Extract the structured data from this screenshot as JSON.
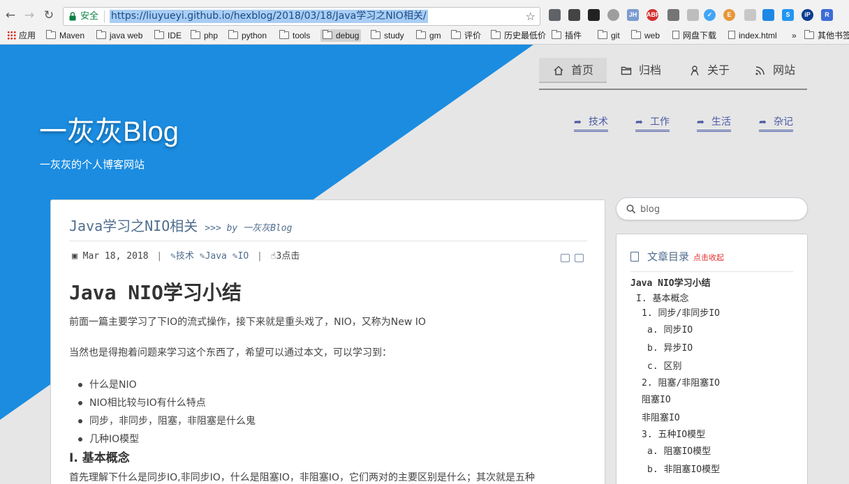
{
  "browser": {
    "back": "←",
    "forward": "→",
    "reload": "↻",
    "secure_label": "安全",
    "url": "https://liuyueyi.github.io/hexblog/2018/03/18/Java学习之NIO相关/",
    "star": "☆",
    "extensions": [
      {
        "icon": "extension-puzzle-icon",
        "text": "",
        "color": "#5f6368"
      },
      {
        "icon": "qr-code-icon",
        "text": "",
        "color": "#444444"
      },
      {
        "icon": "qr-grid-icon",
        "text": "",
        "color": "#222222"
      },
      {
        "icon": "globe-icon",
        "text": "",
        "color": "#9e9e9e"
      },
      {
        "icon": "jh-icon",
        "text": "JH",
        "color": "#7b9bd1"
      },
      {
        "icon": "adblock-icon",
        "text": "ABP",
        "color": "#d32f2f"
      },
      {
        "icon": "gear-icon",
        "text": "",
        "color": "#757575"
      },
      {
        "icon": "tree-icon",
        "text": "",
        "color": "#bdbdbd"
      },
      {
        "icon": "check-icon",
        "text": "✓",
        "color": "#42a5f5"
      },
      {
        "icon": "e-icon",
        "text": "E",
        "color": "#e6963a"
      },
      {
        "icon": "gray-box-icon",
        "text": "",
        "color": "#c7c7c7"
      },
      {
        "icon": "pocket-icon",
        "text": "",
        "color": "#1e88e5"
      },
      {
        "icon": "s-icon",
        "text": "S",
        "color": "#2196f3"
      },
      {
        "icon": "ip-icon",
        "text": "iP",
        "color": "#0b3d91"
      },
      {
        "icon": "r-icon",
        "text": "R",
        "color": "#3d6bd8"
      }
    ],
    "bookmarks": [
      {
        "label": "应用",
        "kind": "apps"
      },
      {
        "label": "Maven",
        "kind": "folder"
      },
      {
        "label": "java web",
        "kind": "folder"
      },
      {
        "label": "IDE",
        "kind": "folder"
      },
      {
        "label": "php",
        "kind": "folder"
      },
      {
        "label": "python",
        "kind": "folder"
      },
      {
        "label": "tools",
        "kind": "folder"
      },
      {
        "label": "debug",
        "kind": "folder"
      },
      {
        "label": "study",
        "kind": "folder"
      },
      {
        "label": "gm",
        "kind": "folder"
      },
      {
        "label": "评价",
        "kind": "folder"
      },
      {
        "label": "历史最低价",
        "kind": "folder"
      },
      {
        "label": "插件",
        "kind": "folder"
      },
      {
        "label": "git",
        "kind": "folder"
      },
      {
        "label": "web",
        "kind": "folder"
      },
      {
        "label": "网盘下载",
        "kind": "page"
      },
      {
        "label": "index.html",
        "kind": "page"
      },
      {
        "label": "»",
        "kind": "more"
      },
      {
        "label": "其他书签",
        "kind": "folder"
      }
    ]
  },
  "site": {
    "title": "一灰灰Blog",
    "subtitle": "一灰灰的个人博客网站",
    "colors": {
      "hero": "#1b8ce0",
      "accent": "#4a59a3"
    },
    "nav": [
      {
        "label": "首页",
        "icon": "home-icon"
      },
      {
        "label": "归档",
        "icon": "folder-icon"
      },
      {
        "label": "关于",
        "icon": "person-icon"
      },
      {
        "label": "网站",
        "icon": "rss-icon"
      }
    ],
    "categories": [
      {
        "label": "技术",
        "icon": "share-icon"
      },
      {
        "label": "工作",
        "icon": "share-icon"
      },
      {
        "label": "生活",
        "icon": "share-icon"
      },
      {
        "label": "杂记",
        "icon": "share-icon"
      }
    ]
  },
  "post": {
    "title": "Java学习之NIO相关",
    "by": ">>> by 一灰灰Blog",
    "date": "Mar 18, 2018",
    "tags": [
      "技术",
      "Java",
      "IO"
    ],
    "clicks": "3点击",
    "heading": "Java NIO学习小结",
    "p1": "前面一篇主要学习了下IO的流式操作，接下来就是重头戏了，NIO，又称为New IO",
    "p2": "当然也是得抱着问题来学习这个东西了，希望可以通过本文，可以学习到：",
    "bullets": [
      "什么是NIO",
      "NIO相比较与IO有什么特点",
      "同步，非同步，阻塞，非阻塞是什么鬼",
      "几种IO模型"
    ],
    "h2": "I. 基本概念",
    "p3": "首先理解下什么是同步IO,非同步IO，什么是阻塞IO，非阻塞IO，它们两对的主要区别是什么；其次就是五种"
  },
  "sidebar": {
    "search_placeholder": "blog",
    "toc_title": "文章目录",
    "toc_collapse": "点击收起",
    "toc": [
      {
        "text": "Java NIO学习小结",
        "level": "l0"
      },
      {
        "text": "I. 基本概念",
        "level": "l1"
      },
      {
        "text": "1. 同步/非同步IO",
        "level": "l2"
      },
      {
        "text": "a. 同步IO",
        "level": "l3"
      },
      {
        "text": "b. 异步IO",
        "level": "l3"
      },
      {
        "text": "c. 区别",
        "level": "l3"
      },
      {
        "text": "2. 阻塞/非阻塞IO",
        "level": "l2"
      },
      {
        "text": "阻塞IO",
        "level": "lp"
      },
      {
        "text": "非阻塞IO",
        "level": "lp"
      },
      {
        "text": "3. 五种IO模型",
        "level": "l2"
      },
      {
        "text": "a. 阻塞IO模型",
        "level": "l3"
      },
      {
        "text": "b. 非阻塞IO模型",
        "level": "l3"
      }
    ]
  }
}
